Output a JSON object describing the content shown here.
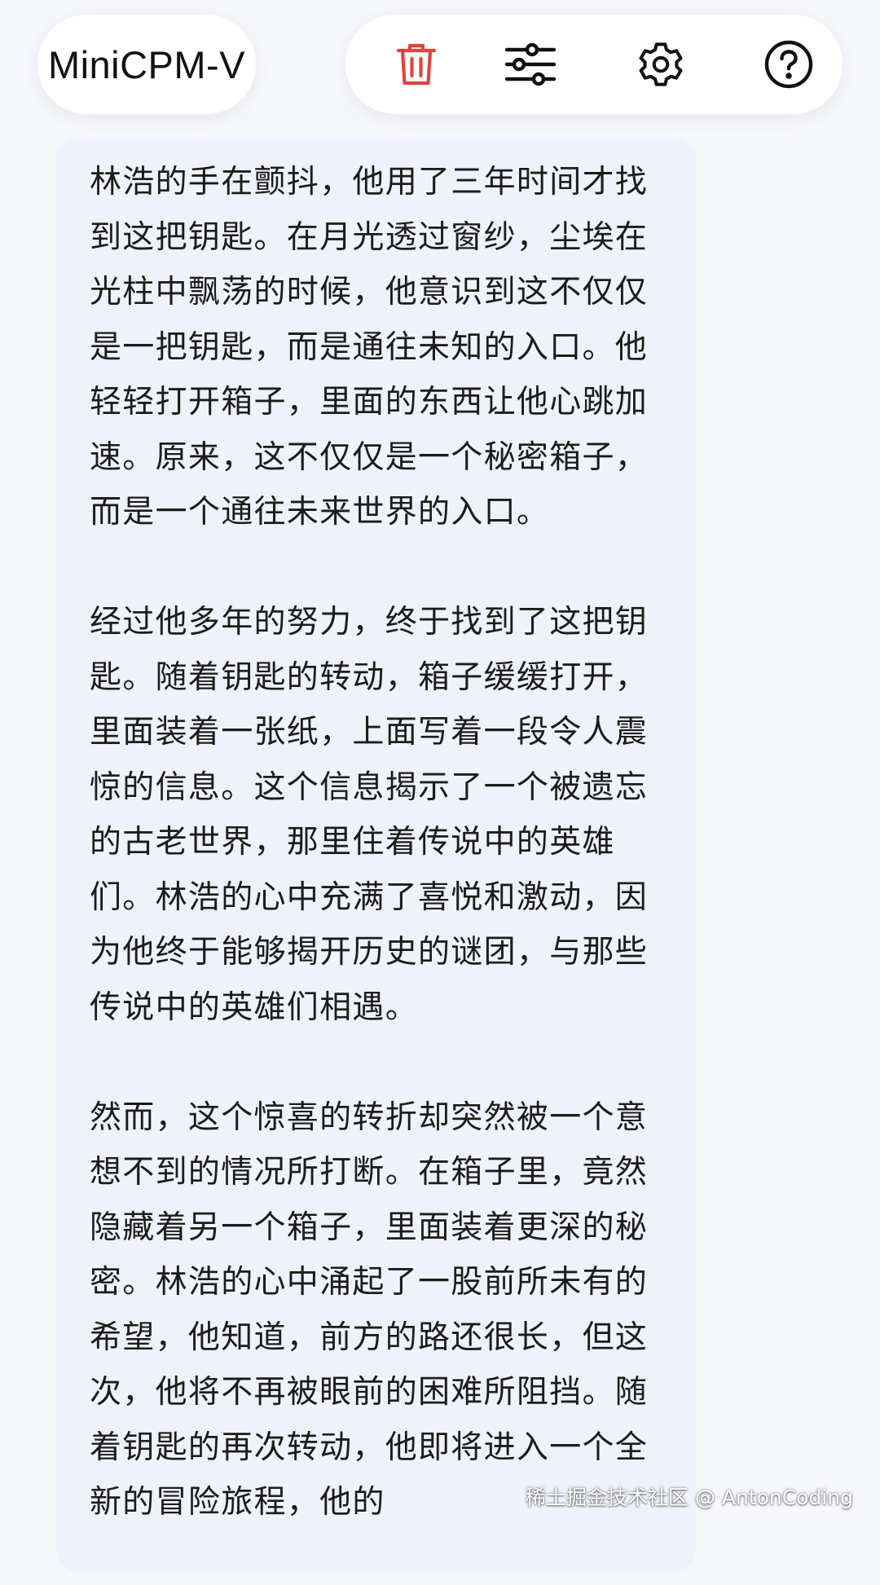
{
  "header": {
    "app_title": "MiniCPM-V"
  },
  "toolbar": {
    "buttons": [
      {
        "name": "delete",
        "icon": "trash-icon",
        "color": "#e0453a"
      },
      {
        "name": "params",
        "icon": "sliders-icon",
        "color": "#111111"
      },
      {
        "name": "settings",
        "icon": "gear-icon",
        "color": "#111111"
      },
      {
        "name": "help",
        "icon": "question-circle-icon",
        "color": "#111111"
      }
    ]
  },
  "message": {
    "paragraphs": [
      "林浩的手在颤抖，他用了三年时间才找到这把钥匙。在月光透过窗纱，尘埃在光柱中飘荡的时候，他意识到这不仅仅是一把钥匙，而是通往未知的入口。他轻轻打开箱子，里面的东西让他心跳加速。原来，这不仅仅是一个秘密箱子，而是一个通往未来世界的入口。",
      "经过他多年的努力，终于找到了这把钥匙。随着钥匙的转动，箱子缓缓打开，里面装着一张纸，上面写着一段令人震惊的信息。这个信息揭示了一个被遗忘的古老世界，那里住着传说中的英雄们。林浩的心中充满了喜悦和激动，因为他终于能够揭开历史的谜团，与那些传说中的英雄们相遇。",
      "然而，这个惊喜的转折却突然被一个意想不到的情况所打断。在箱子里，竟然隐藏着另一个箱子，里面装着更深的秘密。林浩的心中涌起了一股前所未有的希望，他知道，前方的路还很长，但这次，他将不再被眼前的困难所阻挡。随着钥匙的再次转动，他即将进入一个全新的冒险旅程，他的"
    ]
  },
  "watermark": "稀土掘金技术社区 @ AntonCoding"
}
